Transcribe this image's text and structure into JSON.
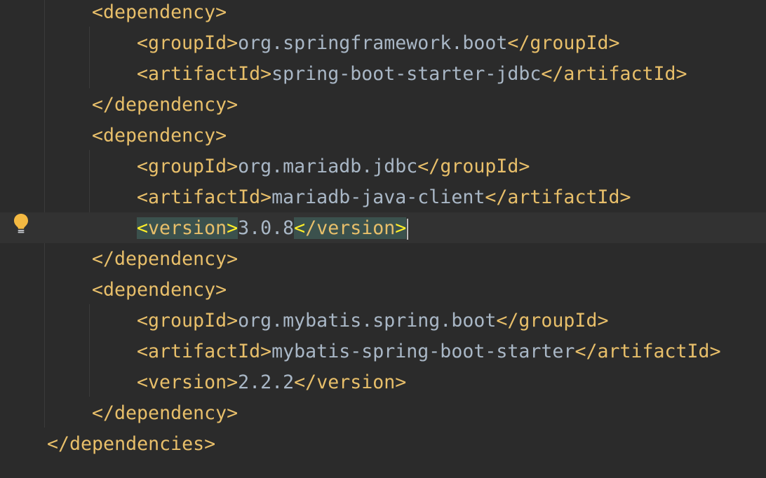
{
  "editor": {
    "lines": [
      {
        "indent": 2,
        "open": "<dependency>",
        "value": "",
        "close": ""
      },
      {
        "indent": 3,
        "open": "<groupId>",
        "value": "org.springframework.boot",
        "close": "</groupId>"
      },
      {
        "indent": 3,
        "open": "<artifactId>",
        "value": "spring-boot-starter-jdbc",
        "close": "</artifactId>"
      },
      {
        "indent": 2,
        "open": "</dependency>",
        "value": "",
        "close": ""
      },
      {
        "indent": 2,
        "open": "<dependency>",
        "value": "",
        "close": ""
      },
      {
        "indent": 3,
        "open": "<groupId>",
        "value": "org.mariadb.jdbc",
        "close": "</groupId>"
      },
      {
        "indent": 3,
        "open": "<artifactId>",
        "value": "mariadb-java-client",
        "close": "</artifactId>"
      },
      {
        "indent": 3,
        "open": "<version>",
        "value": "3.0.8",
        "close": "</version>",
        "caret": true
      },
      {
        "indent": 2,
        "open": "</dependency>",
        "value": "",
        "close": ""
      },
      {
        "indent": 2,
        "open": "<dependency>",
        "value": "",
        "close": ""
      },
      {
        "indent": 3,
        "open": "<groupId>",
        "value": "org.mybatis.spring.boot",
        "close": "</groupId>"
      },
      {
        "indent": 3,
        "open": "<artifactId>",
        "value": "mybatis-spring-boot-starter",
        "close": "</artifactId>"
      },
      {
        "indent": 3,
        "open": "<version>",
        "value": "2.2.2",
        "close": "</version>"
      },
      {
        "indent": 2,
        "open": "</dependency>",
        "value": "",
        "close": ""
      },
      {
        "indent": 1,
        "open": "</dependencies>",
        "value": "",
        "close": ""
      }
    ]
  },
  "gutter": {
    "intention_icon": "lightbulb-icon"
  },
  "colors": {
    "background": "#2b2b2b",
    "caret_row": "#323232",
    "tag": "#e8bf6a",
    "text": "#a9b7c6",
    "tag_match_bg": "#3b514d",
    "bulb": "#f4b942"
  }
}
